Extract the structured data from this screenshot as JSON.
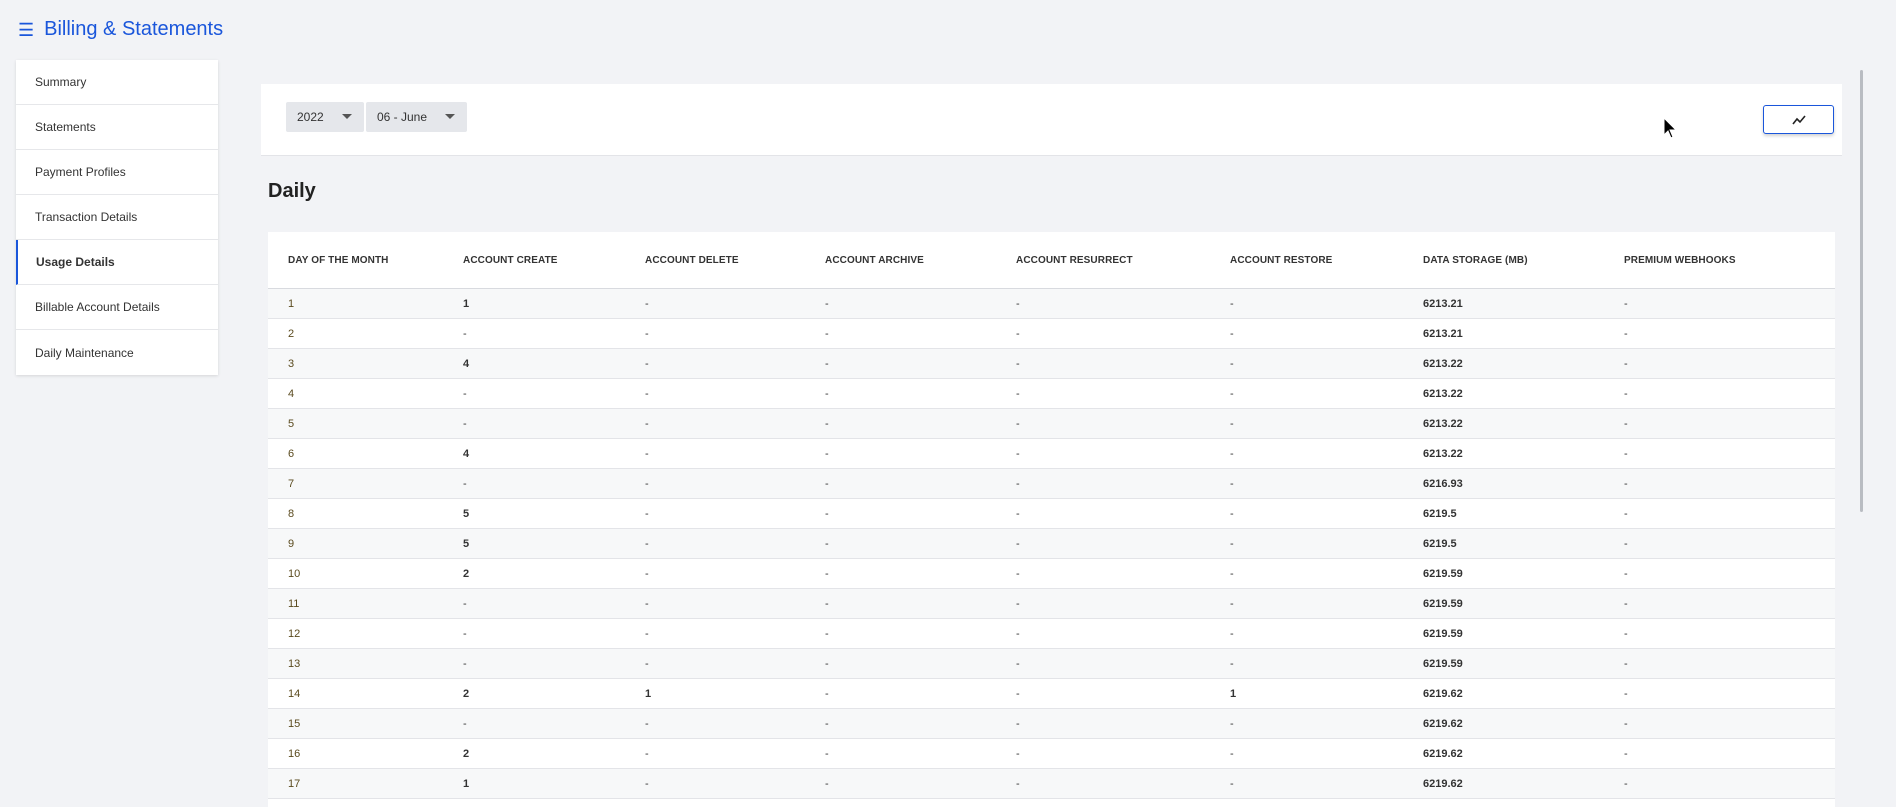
{
  "app": {
    "title": "Billing & Statements",
    "menu_icon": "hamburger-icon"
  },
  "sidebar": {
    "items": [
      {
        "label": "Summary",
        "active": false
      },
      {
        "label": "Statements",
        "active": false
      },
      {
        "label": "Payment Profiles",
        "active": false
      },
      {
        "label": "Transaction Details",
        "active": false
      },
      {
        "label": "Usage Details",
        "active": true
      },
      {
        "label": "Billable Account Details",
        "active": false
      },
      {
        "label": "Daily Maintenance",
        "active": false
      }
    ]
  },
  "toolbar": {
    "year": "2022",
    "month": "06 - June",
    "chart_button_icon": "line-chart-icon"
  },
  "section": {
    "title": "Daily"
  },
  "table": {
    "columns": [
      "Day of the Month",
      "Account Create",
      "Account Delete",
      "Account Archive",
      "Account Resurrect",
      "Account Restore",
      "Data Storage (MB)",
      "Premium Webhooks"
    ],
    "rows": [
      [
        "1",
        "1",
        "-",
        "-",
        "-",
        "-",
        "6213.21",
        "-"
      ],
      [
        "2",
        "-",
        "-",
        "-",
        "-",
        "-",
        "6213.21",
        "-"
      ],
      [
        "3",
        "4",
        "-",
        "-",
        "-",
        "-",
        "6213.22",
        "-"
      ],
      [
        "4",
        "-",
        "-",
        "-",
        "-",
        "-",
        "6213.22",
        "-"
      ],
      [
        "5",
        "-",
        "-",
        "-",
        "-",
        "-",
        "6213.22",
        "-"
      ],
      [
        "6",
        "4",
        "-",
        "-",
        "-",
        "-",
        "6213.22",
        "-"
      ],
      [
        "7",
        "-",
        "-",
        "-",
        "-",
        "-",
        "6216.93",
        "-"
      ],
      [
        "8",
        "5",
        "-",
        "-",
        "-",
        "-",
        "6219.5",
        "-"
      ],
      [
        "9",
        "5",
        "-",
        "-",
        "-",
        "-",
        "6219.5",
        "-"
      ],
      [
        "10",
        "2",
        "-",
        "-",
        "-",
        "-",
        "6219.59",
        "-"
      ],
      [
        "11",
        "-",
        "-",
        "-",
        "-",
        "-",
        "6219.59",
        "-"
      ],
      [
        "12",
        "-",
        "-",
        "-",
        "-",
        "-",
        "6219.59",
        "-"
      ],
      [
        "13",
        "-",
        "-",
        "-",
        "-",
        "-",
        "6219.59",
        "-"
      ],
      [
        "14",
        "2",
        "1",
        "-",
        "-",
        "1",
        "6219.62",
        "-"
      ],
      [
        "15",
        "-",
        "-",
        "-",
        "-",
        "-",
        "6219.62",
        "-"
      ],
      [
        "16",
        "2",
        "-",
        "-",
        "-",
        "-",
        "6219.62",
        "-"
      ],
      [
        "17",
        "1",
        "-",
        "-",
        "-",
        "-",
        "6219.62",
        "-"
      ]
    ]
  },
  "colors": {
    "accent": "#1a56db",
    "background": "#f2f3f6"
  }
}
